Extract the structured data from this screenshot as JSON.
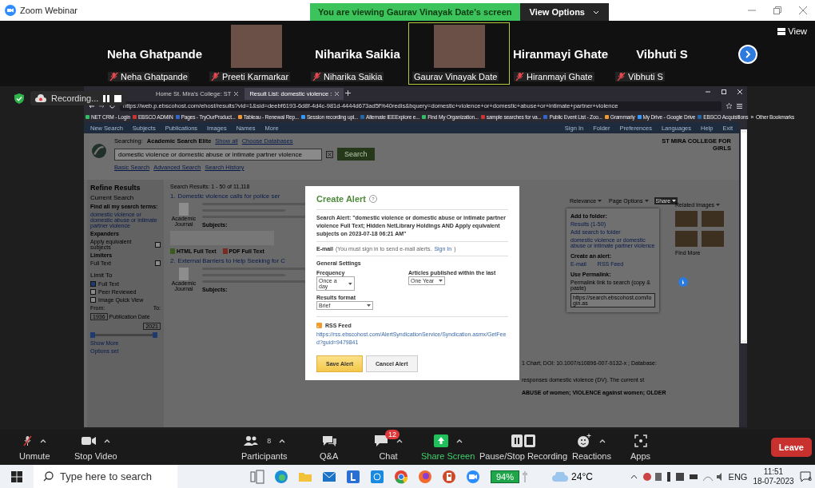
{
  "window": {
    "title": "Zoom Webinar"
  },
  "banner": {
    "text": "You are viewing Gaurav Vinayak Date's screen",
    "view_options": "View Options"
  },
  "view_button": "View",
  "participants": [
    {
      "name": "Neha Ghatpande",
      "label": "Neha Ghatpande",
      "video": false,
      "muted": true,
      "selected": false
    },
    {
      "label": "Preeti Karmarkar",
      "video": true,
      "muted": true,
      "selected": false
    },
    {
      "name": "Niharika Saikia",
      "label": "Niharika Saikia",
      "video": false,
      "muted": true,
      "selected": false
    },
    {
      "label": "Gaurav Vinayak Date",
      "video": true,
      "muted": false,
      "selected": true
    },
    {
      "name": "Hiranmayi Ghate",
      "label": "Hiranmayi Ghate",
      "video": false,
      "muted": true,
      "selected": false
    },
    {
      "name": "Vibhuti S",
      "label": "Vibhuti S",
      "video": false,
      "muted": true,
      "selected": false
    }
  ],
  "recording": {
    "label": "Recording..."
  },
  "browser": {
    "tabs": [
      {
        "label": "Home St. Mira's College: ST",
        "selected": false
      },
      {
        "label": "Result List: domestic violence :",
        "selected": true
      }
    ],
    "url": "https://web.p.ebscohost.com/ehost/results?vid=1&sid=deebf6193-6d8f-4d4c-981d-4444d673ad5f%40redis&bquery=domestic+violence+or+domestic+abuse+or+intimate+partner+violence",
    "bookmarks": [
      "NET CRM - Login",
      "EBSCO ADMIN",
      "Pages - TryOurProduct...",
      "Tableau - Renewal Rep...",
      "Session recording upl...",
      "Alternate IEEExplore e...",
      "Find My Organization...",
      "sample searches for va...",
      "Public Event List - Zoo...",
      "Grammarly",
      "My Drive - Google Drive",
      "EBSCO Acquisitions"
    ],
    "more_bookmarks": "»",
    "other_bookmarks": "Other Bookmarks"
  },
  "ebsco": {
    "nav_left": [
      "New Search",
      "Subjects",
      "Publications",
      "Images",
      "Names",
      "More"
    ],
    "nav_right": [
      "Sign In",
      "Folder",
      "Preferences",
      "Languages",
      "Help",
      "Exit"
    ],
    "searching_label": "Searching:",
    "database": "Academic Search Elite",
    "show_all": "Show all",
    "choose_databases": "Choose Databases",
    "query": "domestic violence or domestic abuse or intimate partner violence",
    "search_button": "Search",
    "search_links": [
      "Basic Search",
      "Advanced Search",
      "Search History"
    ],
    "institution": "ST MIRA COLLEGE FOR GIRLS"
  },
  "sidebar": {
    "title": "Refine Results",
    "current_search": "Current Search",
    "find_all": "Find all my search terms:",
    "query": "domestic violence or domestic abuse or intimate partner violence",
    "sections": [
      {
        "title": "Expanders",
        "items": [
          {
            "label": "Apply equivalent subjects",
            "checked": false
          }
        ]
      },
      {
        "title": "Limiters",
        "items": [
          {
            "label": "Full Text",
            "checked": false
          }
        ]
      }
    ],
    "limit_to": "Limit To",
    "limits": [
      {
        "label": "Full Text",
        "checked": true
      },
      {
        "label": "Peer Reviewed",
        "checked": false
      },
      {
        "label": "Image Quick View",
        "checked": false
      }
    ],
    "date_slider": {
      "low": {
        "level": 0
      },
      "high": {
        "level": 1
      }
    },
    "from_label": "From:",
    "to_label": "To:",
    "from": "1936",
    "publication_date": "Publication Date",
    "to": "2021",
    "show_more": "Show More",
    "options_set": "Options set"
  },
  "results": {
    "summary": "Search Results: 1 - 50 of 11,118",
    "items": [
      {
        "number": "1.",
        "title": "Domestic violence calls for police ser",
        "type": "Academic Journal",
        "subjects_label": "Subjects:",
        "links": [
          "HTML Full Text",
          "PDF Full Text"
        ]
      },
      {
        "number": "2.",
        "title": "External Barriers to Help Seeking for C",
        "type": "Academic Journal",
        "subjects_label": "Subjects:"
      }
    ],
    "fragments": [
      "1 Chart; DOI: 10.1007/s10896-007-9132-x ; Database:",
      "responses domestic violence (DV). The current st",
      "ABUSE of women; VIOLENCE against women; OLDER"
    ]
  },
  "result_tools": [
    {
      "label": "Relevance",
      "selected": false
    },
    {
      "label": "Page Options",
      "selected": false
    },
    {
      "label": "Share",
      "selected": true
    }
  ],
  "share_menu": {
    "add_to_folder": "Add to folder:",
    "results": "Results (1-50)",
    "add_search": "Add search to folder",
    "search_name": "domestic violence or domestic abuse or intimate partner violence",
    "create_alert": "Create an alert:",
    "email": "E-mail",
    "rss": "RSS Feed",
    "permalink_label": "Use Permalink:",
    "permalink_hint": "Permalink link to search (copy & paste)",
    "permalink": "https://search.ebscohost.com/login.as"
  },
  "related_images": {
    "title": "Related Images",
    "find_more": "Find More"
  },
  "modal": {
    "title": "Create Alert",
    "help": "?",
    "search_alert": "Search Alert: \"domestic violence or domestic abuse or intimate partner violence Full Text; Hidden NetLibrary Holdings AND Apply equivalent subjects on 2023-07-18 06:21 AM\"",
    "email_label": "E-mail",
    "email_note": "(You must sign in to send e-mail alerts.",
    "sign_in": "Sign In",
    "email_note_end": ")",
    "general_settings": "General Settings",
    "frequency_label": "Frequency",
    "frequency": "Once a day",
    "published_label": "Articles published within the last",
    "published": "One Year",
    "format_label": "Results format",
    "format": "Brief",
    "rss_label": "RSS Feed",
    "rss_url": "https://rss.ebscohost.com/AlertSyndicationService/Syndication.asmx/GetFeed?guid=9479841",
    "save": "Save Alert",
    "cancel": "Cancel Alert"
  },
  "zoom_toolbar": {
    "items": [
      {
        "kind": "mic",
        "label": "Unmute",
        "menu": true
      },
      {
        "kind": "video",
        "label": "Stop Video",
        "menu": true
      },
      {
        "kind": "participants",
        "label": "Participants",
        "count": "8",
        "menu": true
      },
      {
        "kind": "qa",
        "label": "Q&A",
        "menu": false
      },
      {
        "kind": "chat",
        "label": "Chat",
        "badge": "12",
        "menu": true
      },
      {
        "kind": "share",
        "label": "Share Screen",
        "menu": true
      },
      {
        "kind": "record",
        "label": "Pause/Stop Recording",
        "menu": false
      },
      {
        "kind": "reactions",
        "label": "Reactions",
        "menu": true
      },
      {
        "kind": "apps",
        "label": "Apps",
        "menu": false
      }
    ],
    "leave": "Leave"
  },
  "taskbar": {
    "search_placeholder": "Type here to search",
    "apps": [
      {
        "kind": "task-view"
      },
      {
        "kind": "browser"
      },
      {
        "kind": "folder"
      },
      {
        "kind": "mail"
      },
      {
        "kind": "letter"
      },
      {
        "kind": "square"
      },
      {
        "kind": "chrome"
      },
      {
        "kind": "firefox"
      },
      {
        "kind": "slides"
      },
      {
        "kind": "video"
      }
    ],
    "battery": "94%",
    "weather": "24°C",
    "language": "ENG",
    "time": "11:51",
    "date": "18-07-2023",
    "notifications": "6"
  }
}
